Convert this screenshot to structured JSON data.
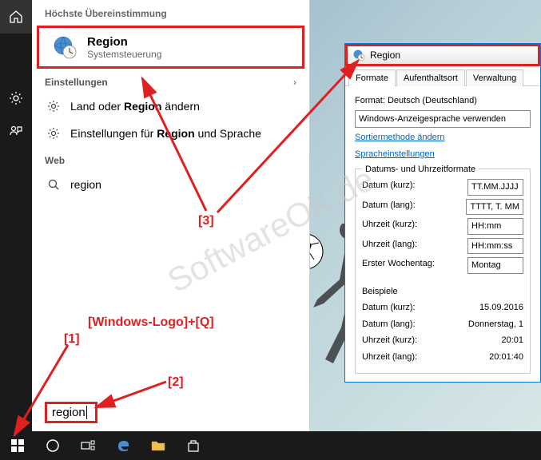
{
  "search": {
    "header": "Höchste Übereinstimmung",
    "topResult": {
      "title": "Region",
      "subtitle": "Systemsteuerung"
    },
    "categories": {
      "settings": "Einstellungen",
      "web": "Web"
    },
    "settingsResults": [
      "Land oder Region ändern",
      "Einstellungen für Region und Sprache"
    ],
    "webResults": [
      "region"
    ],
    "input": "region"
  },
  "dialog": {
    "title": "Region",
    "tabs": [
      "Formate",
      "Aufenthaltsort",
      "Verwaltung"
    ],
    "formatLabel": "Format:",
    "formatValue": "Deutsch (Deutschland)",
    "displayLangBtn": "Windows-Anzeigesprache verwenden",
    "links": {
      "sort": "Sortiermethode ändern",
      "lang": "Spracheinstellungen"
    },
    "dtGroupTitle": "Datums- und Uhrzeitformate",
    "rows": [
      {
        "label": "Datum (kurz):",
        "value": "TT.MM.JJJJ"
      },
      {
        "label": "Datum (lang):",
        "value": "TTTT, T. MM"
      },
      {
        "label": "Uhrzeit (kurz):",
        "value": "HH:mm"
      },
      {
        "label": "Uhrzeit (lang):",
        "value": "HH:mm:ss"
      },
      {
        "label": "Erster Wochentag:",
        "value": "Montag"
      }
    ],
    "examplesTitle": "Beispiele",
    "examples": [
      {
        "label": "Datum (kurz):",
        "value": "15.09.2016"
      },
      {
        "label": "Datum (lang):",
        "value": "Donnerstag, 1"
      },
      {
        "label": "Uhrzeit (kurz):",
        "value": "20:01"
      },
      {
        "label": "Uhrzeit (lang):",
        "value": "20:01:40"
      }
    ]
  },
  "annotations": {
    "hint": "[Windows-Logo]+[Q]",
    "n1": "[1]",
    "n2": "[2]",
    "n3": "[3]"
  },
  "watermark": "SoftwareOK.de"
}
